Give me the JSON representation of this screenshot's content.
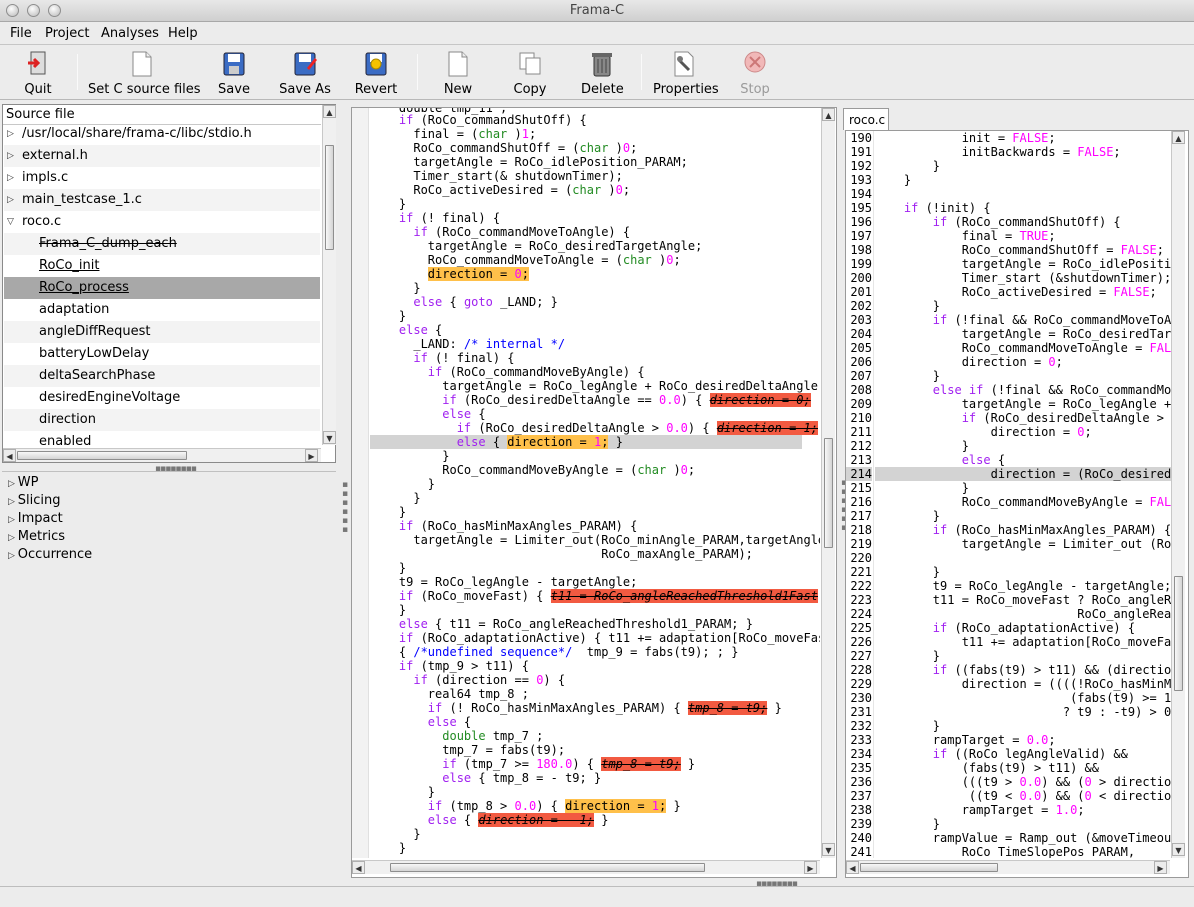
{
  "window": {
    "title": "Frama-C"
  },
  "menu": [
    "File",
    "Project",
    "Analyses",
    "Help"
  ],
  "toolbar": {
    "quit": "Quit",
    "set_c": "Set C source files",
    "save": "Save",
    "save_as": "Save As",
    "revert": "Revert",
    "new": "New",
    "copy": "Copy",
    "delete": "Delete",
    "properties": "Properties",
    "stop": "Stop"
  },
  "source_file": {
    "header": "Source file",
    "files": [
      "/usr/local/share/frama-c/libc/stdio.h",
      "external.h",
      "impls.c",
      "main_testcase_1.c",
      "roco.c"
    ],
    "functions": [
      "Frama_C_dump_each",
      "RoCo_init",
      "RoCo_process",
      "adaptation",
      "angleDiffRequest",
      "batteryLowDelay",
      "deltaSearchPhase",
      "desiredEngineVoltage",
      "direction",
      "enabled"
    ]
  },
  "plugins": [
    "WP",
    "Slicing",
    "Impact",
    "Metrics",
    "Occurrence"
  ],
  "right_tab": "roco.c",
  "line_numbers": [
    "190",
    "191",
    "192",
    "193",
    "194",
    "195",
    "196",
    "197",
    "198",
    "199",
    "200",
    "201",
    "202",
    "203",
    "204",
    "205",
    "206",
    "207",
    "208",
    "209",
    "210",
    "211",
    "212",
    "213",
    "214",
    "215",
    "216",
    "217",
    "218",
    "219",
    "220",
    "221",
    "222",
    "223",
    "224",
    "225",
    "226",
    "227",
    "228",
    "229",
    "230",
    "231",
    "232",
    "233",
    "234",
    "235",
    "236",
    "237",
    "238",
    "239",
    "240",
    "241"
  ]
}
